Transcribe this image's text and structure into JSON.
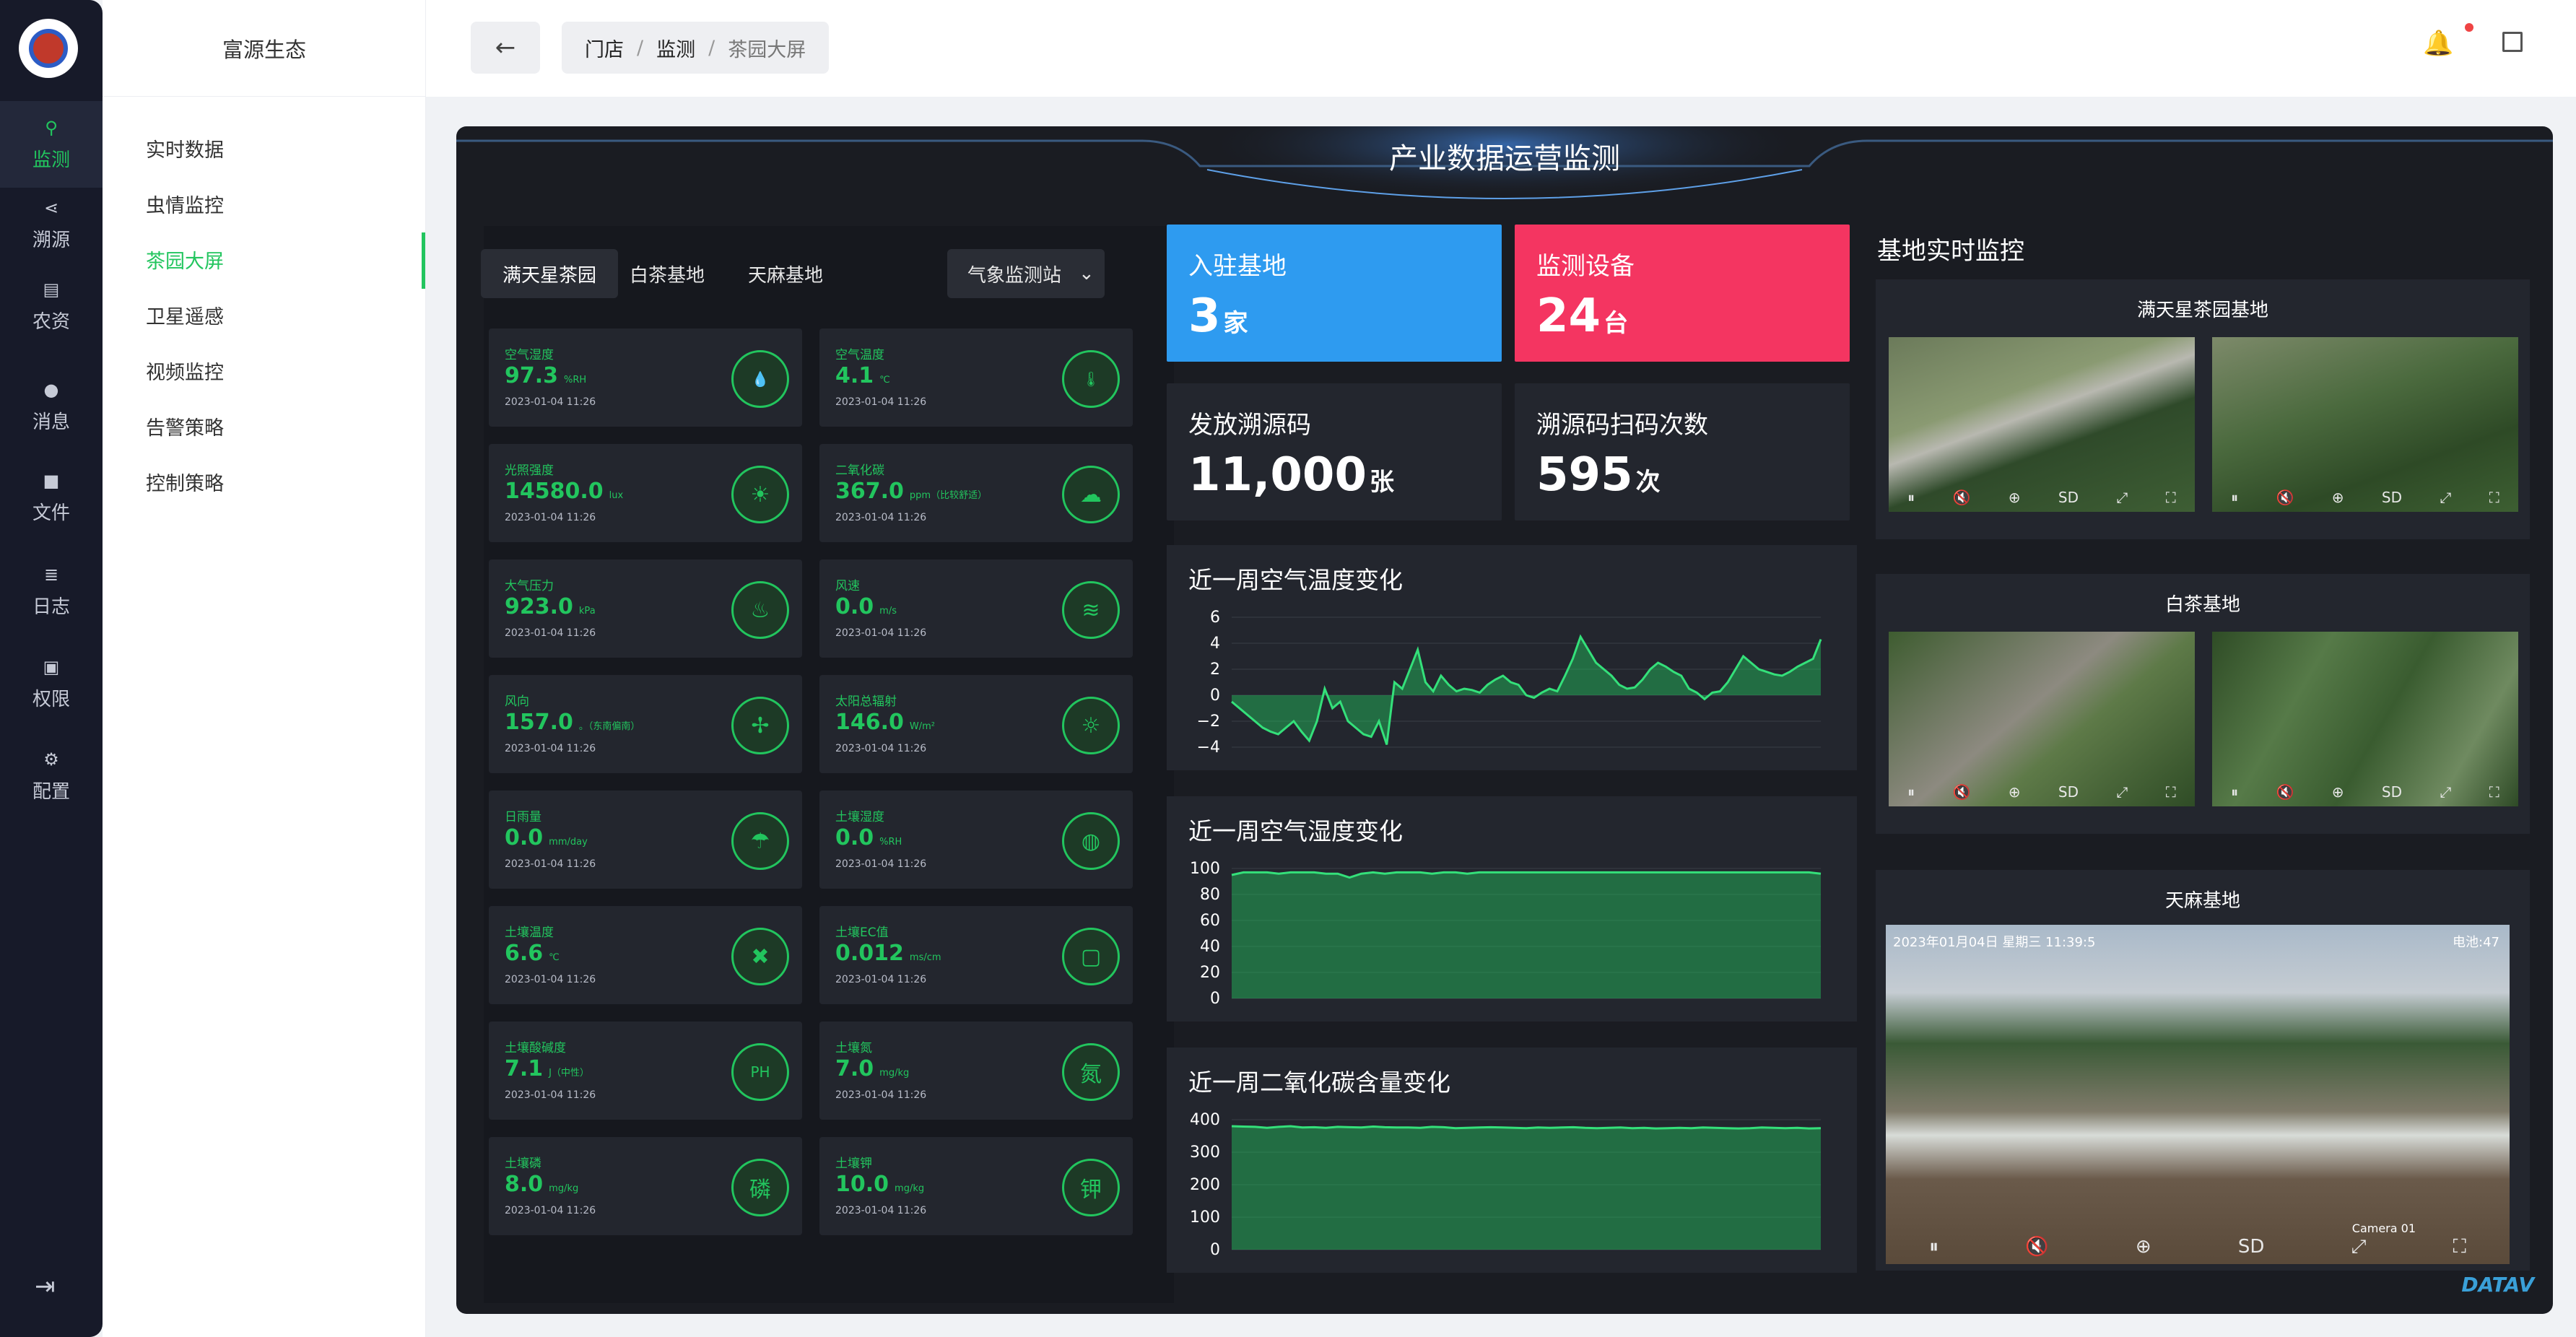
{
  "nav": {
    "items": [
      {
        "label": "监测",
        "icon": "monitor-icon",
        "glyph": "⚲"
      },
      {
        "label": "溯源",
        "icon": "share-icon",
        "glyph": "⋖"
      },
      {
        "label": "农资",
        "icon": "box-icon",
        "glyph": "▤"
      },
      {
        "label": "消息",
        "icon": "chat-icon",
        "glyph": "●"
      },
      {
        "label": "文件",
        "icon": "folder-icon",
        "glyph": "■"
      },
      {
        "label": "日志",
        "icon": "database-icon",
        "glyph": "≣"
      },
      {
        "label": "权限",
        "icon": "id-card-icon",
        "glyph": "▣"
      },
      {
        "label": "配置",
        "icon": "gears-icon",
        "glyph": "⚙"
      }
    ],
    "logout_glyph": "⇥"
  },
  "sub": {
    "title": "富源生态",
    "items": [
      "实时数据",
      "虫情监控",
      "茶园大屏",
      "卫星遥感",
      "视频监控",
      "告警策略",
      "控制策略"
    ]
  },
  "top": {
    "back_glyph": "←",
    "crumbs": [
      "门店",
      "监测",
      "茶园大屏"
    ],
    "sep": "/",
    "bell_glyph": "🔔"
  },
  "screen": {
    "title": "产业数据运营监测",
    "tabs": [
      "满天星茶园",
      "白茶基地",
      "天麻基地"
    ],
    "station": "气象监测站",
    "station_arrow": "⌄",
    "sensors": [
      {
        "label": "空气湿度",
        "value": "97.3",
        "unit": "%RH",
        "time": "2023-01-04 11:26",
        "glyph": "💧"
      },
      {
        "label": "空气温度",
        "value": "4.1",
        "unit": "℃",
        "time": "2023-01-04 11:26",
        "glyph": "🌡"
      },
      {
        "label": "光照强度",
        "value": "14580.0",
        "unit": "lux",
        "time": "2023-01-04 11:26",
        "glyph": "☀"
      },
      {
        "label": "二氧化碳",
        "value": "367.0",
        "unit": "ppm（比较舒适）",
        "time": "2023-01-04 11:26",
        "glyph": "☁"
      },
      {
        "label": "大气压力",
        "value": "923.0",
        "unit": "kPa",
        "time": "2023-01-04 11:26",
        "glyph": "♨"
      },
      {
        "label": "风速",
        "value": "0.0",
        "unit": "m/s",
        "time": "2023-01-04 11:26",
        "glyph": "≋"
      },
      {
        "label": "风向",
        "value": "157.0",
        "unit": "。（东南偏南）",
        "time": "2023-01-04 11:26",
        "glyph": "✢"
      },
      {
        "label": "太阳总辐射",
        "value": "146.0",
        "unit": "W/m²",
        "time": "2023-01-04 11:26",
        "glyph": "☼"
      },
      {
        "label": "日雨量",
        "value": "0.0",
        "unit": "mm/day",
        "time": "2023-01-04 11:26",
        "glyph": "☂"
      },
      {
        "label": "土壤湿度",
        "value": "0.0",
        "unit": "%RH",
        "time": "2023-01-04 11:26",
        "glyph": "◍"
      },
      {
        "label": "土壤温度",
        "value": "6.6",
        "unit": "℃",
        "time": "2023-01-04 11:26",
        "glyph": "✖"
      },
      {
        "label": "土壤EC值",
        "value": "0.012",
        "unit": "ms/cm",
        "time": "2023-01-04 11:26",
        "glyph": "▢"
      },
      {
        "label": "土壤酸碱度",
        "value": "7.1",
        "unit": "J（中性）",
        "time": "2023-01-04 11:26",
        "glyph": "PH"
      },
      {
        "label": "土壤氮",
        "value": "7.0",
        "unit": "mg/kg",
        "time": "2023-01-04 11:26",
        "glyph": "氮"
      },
      {
        "label": "土壤磷",
        "value": "8.0",
        "unit": "mg/kg",
        "time": "2023-01-04 11:26",
        "glyph": "磷"
      },
      {
        "label": "土壤钾",
        "value": "10.0",
        "unit": "mg/kg",
        "time": "2023-01-04 11:26",
        "glyph": "钾"
      }
    ],
    "stats": [
      {
        "title": "入驻基地",
        "value": "3",
        "unit": "家",
        "color": "#2e9bf0"
      },
      {
        "title": "监测设备",
        "value": "24",
        "unit": "台",
        "color": "#f43561"
      },
      {
        "title": "发放溯源码",
        "value": "11,000",
        "unit": "张",
        "color": "#23262e"
      },
      {
        "title": "溯源码扫码次数",
        "value": "595",
        "unit": "次",
        "color": "#23262e"
      }
    ],
    "right_title": "基地实时监控",
    "cam_groups": [
      "满天星茶园基地",
      "白茶基地",
      "天麻基地"
    ],
    "cam_timestamp": "2023年01月04日 星期三 11:39:5",
    "cam_battery": "电池:47",
    "cam_label": "Camera 01",
    "cam_controls": [
      "⏸",
      "🔇",
      "⊕",
      "SD",
      "⤢",
      "⛶"
    ],
    "watermark": "DATAV"
  },
  "colors": {
    "accent": "#22c55e",
    "blue": "#2e9bf0",
    "red": "#f43561"
  },
  "chart_data": [
    {
      "type": "area",
      "title": "近一周空气温度变化",
      "ylim": [
        -4,
        6
      ],
      "yticks": [
        "6",
        "4",
        "2",
        "0",
        "−2",
        "−4"
      ],
      "values": [
        -0.5,
        -1,
        -1.5,
        -2,
        -2.5,
        -2.8,
        -3,
        -2.5,
        -2,
        -2.8,
        -3.5,
        -2,
        0.5,
        -1,
        -0.5,
        -2,
        -2.5,
        -3,
        -3.2,
        -2,
        -3.8,
        1,
        0.5,
        2,
        3.5,
        1,
        0.3,
        1.5,
        0.8,
        0.3,
        0.5,
        0.4,
        0.2,
        0.8,
        1.2,
        1.5,
        1,
        0.8,
        0,
        -0.2,
        0.2,
        0.5,
        0.3,
        1.5,
        2.8,
        4.5,
        3.5,
        2.5,
        2,
        1.5,
        0.8,
        0.5,
        0.6,
        1.2,
        2,
        2.5,
        2.2,
        1.8,
        1.5,
        0.5,
        0.2,
        -0.3,
        0.2,
        0.3,
        1,
        2,
        3,
        2.5,
        2,
        1.8,
        1.6,
        1.5,
        1.8,
        2.2,
        2.5,
        2.8,
        4.3
      ]
    },
    {
      "type": "area",
      "title": "近一周空气湿度变化",
      "ylim": [
        0,
        100
      ],
      "yticks": [
        "100",
        "80",
        "60",
        "40",
        "20",
        "0"
      ],
      "values": [
        95,
        97,
        97,
        97,
        96,
        97,
        97,
        97,
        96,
        96,
        93,
        96,
        97,
        96,
        97,
        97,
        97,
        96,
        97,
        97,
        96,
        97,
        97,
        97,
        97,
        97,
        97,
        97,
        97,
        97,
        97,
        97,
        97,
        97,
        97,
        97,
        97,
        97,
        97,
        97,
        97,
        97,
        97,
        97,
        97,
        97,
        97,
        97,
        97,
        97,
        96
      ]
    },
    {
      "type": "area",
      "title": "近一周二氧化碳含量变化",
      "ylim": [
        0,
        400
      ],
      "yticks": [
        "400",
        "300",
        "200",
        "100",
        "0"
      ],
      "values": [
        380,
        379,
        378,
        375,
        378,
        380,
        376,
        377,
        375,
        378,
        377,
        376,
        379,
        377,
        376,
        376,
        375,
        378,
        377,
        374,
        375,
        376,
        377,
        376,
        375,
        374,
        376,
        375,
        376,
        377,
        375,
        374,
        375,
        376,
        374,
        375,
        373,
        374,
        375,
        374,
        376,
        375,
        374,
        373,
        374,
        376,
        375,
        374,
        375,
        373,
        374
      ]
    }
  ]
}
